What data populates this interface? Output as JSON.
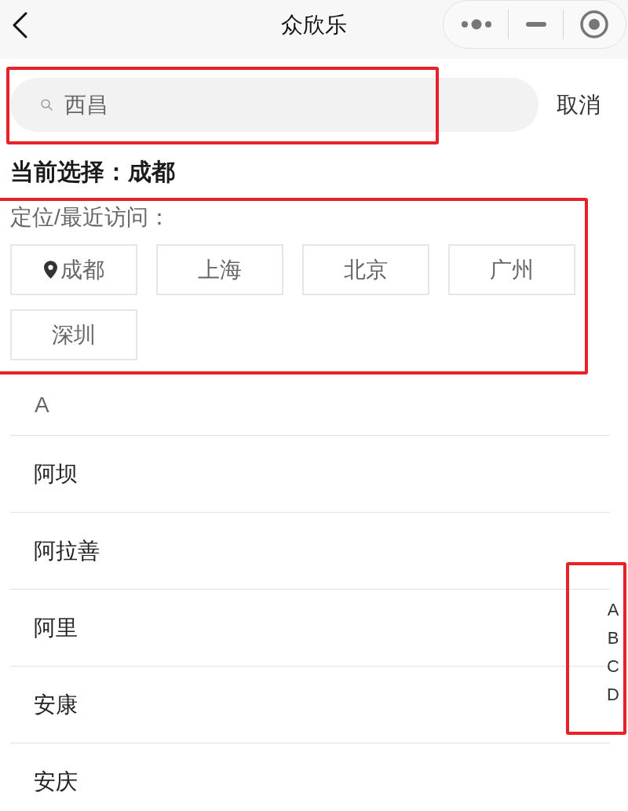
{
  "nav_bar": {
    "title": "众欣乐"
  },
  "search": {
    "value": "西昌",
    "cancel": "取消"
  },
  "current_selection": "当前选择：成都",
  "recent": {
    "label": "定位/最近访问：",
    "cities": [
      {
        "name": "成都",
        "kind": "location"
      },
      {
        "name": "上海",
        "kind": "recent"
      },
      {
        "name": "北京",
        "kind": "recent"
      },
      {
        "name": "广州",
        "kind": "recent"
      },
      {
        "name": "深圳",
        "kind": "recent"
      }
    ]
  },
  "city_list": [
    {
      "letter": "A",
      "cities": [
        {
          "name": "阿坝"
        },
        {
          "name": "阿拉善"
        },
        {
          "name": "阿里"
        },
        {
          "name": "安康"
        },
        {
          "name": "安庆"
        }
      ]
    }
  ],
  "index_bar": [
    {
      "letter": "A"
    },
    {
      "letter": "B"
    },
    {
      "letter": "C"
    },
    {
      "letter": "D"
    }
  ]
}
